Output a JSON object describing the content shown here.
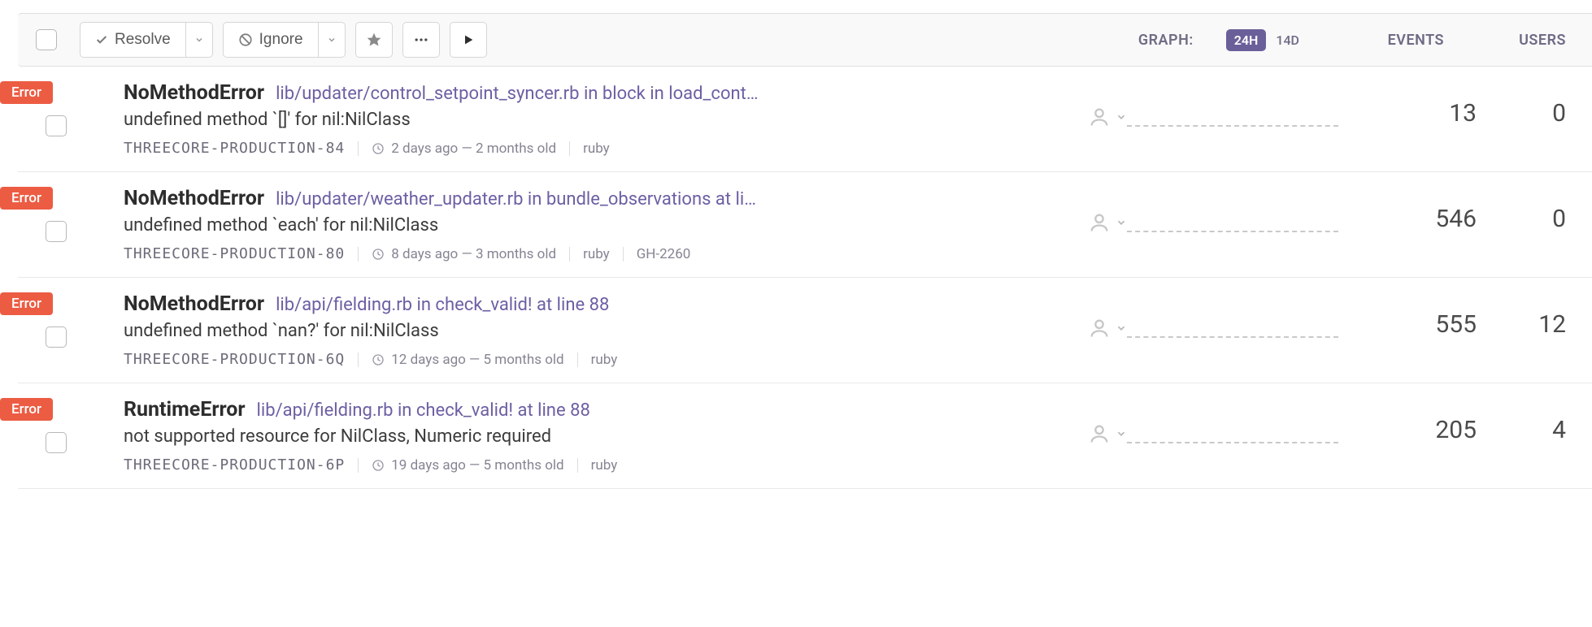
{
  "toolbar": {
    "resolve_label": "Resolve",
    "ignore_label": "Ignore",
    "graph_label": "GRAPH:",
    "range_24h": "24H",
    "range_14d": "14D",
    "events_label": "EVENTS",
    "users_label": "USERS"
  },
  "badge_label": "Error",
  "issues": [
    {
      "type": "NoMethodError",
      "location": "lib/updater/control_setpoint_syncer.rb in block in load_cont…",
      "message": "undefined method `[]' for nil:NilClass",
      "code": "THREECORE-PRODUCTION-84",
      "time": "2 days ago — 2 months old",
      "lang": "ruby",
      "link": "",
      "events": "13",
      "users": "0"
    },
    {
      "type": "NoMethodError",
      "location": "lib/updater/weather_updater.rb in bundle_observations at li…",
      "message": "undefined method `each' for nil:NilClass",
      "code": "THREECORE-PRODUCTION-80",
      "time": "8 days ago — 3 months old",
      "lang": "ruby",
      "link": "GH-2260",
      "events": "546",
      "users": "0"
    },
    {
      "type": "NoMethodError",
      "location": "lib/api/fielding.rb in check_valid! at line 88",
      "message": "undefined method `nan?' for nil:NilClass",
      "code": "THREECORE-PRODUCTION-6Q",
      "time": "12 days ago — 5 months old",
      "lang": "ruby",
      "link": "",
      "events": "555",
      "users": "12"
    },
    {
      "type": "RuntimeError",
      "location": "lib/api/fielding.rb in check_valid! at line 88",
      "message": "not supported resource for NilClass, Numeric required",
      "code": "THREECORE-PRODUCTION-6P",
      "time": "19 days ago — 5 months old",
      "lang": "ruby",
      "link": "",
      "events": "205",
      "users": "4"
    }
  ]
}
